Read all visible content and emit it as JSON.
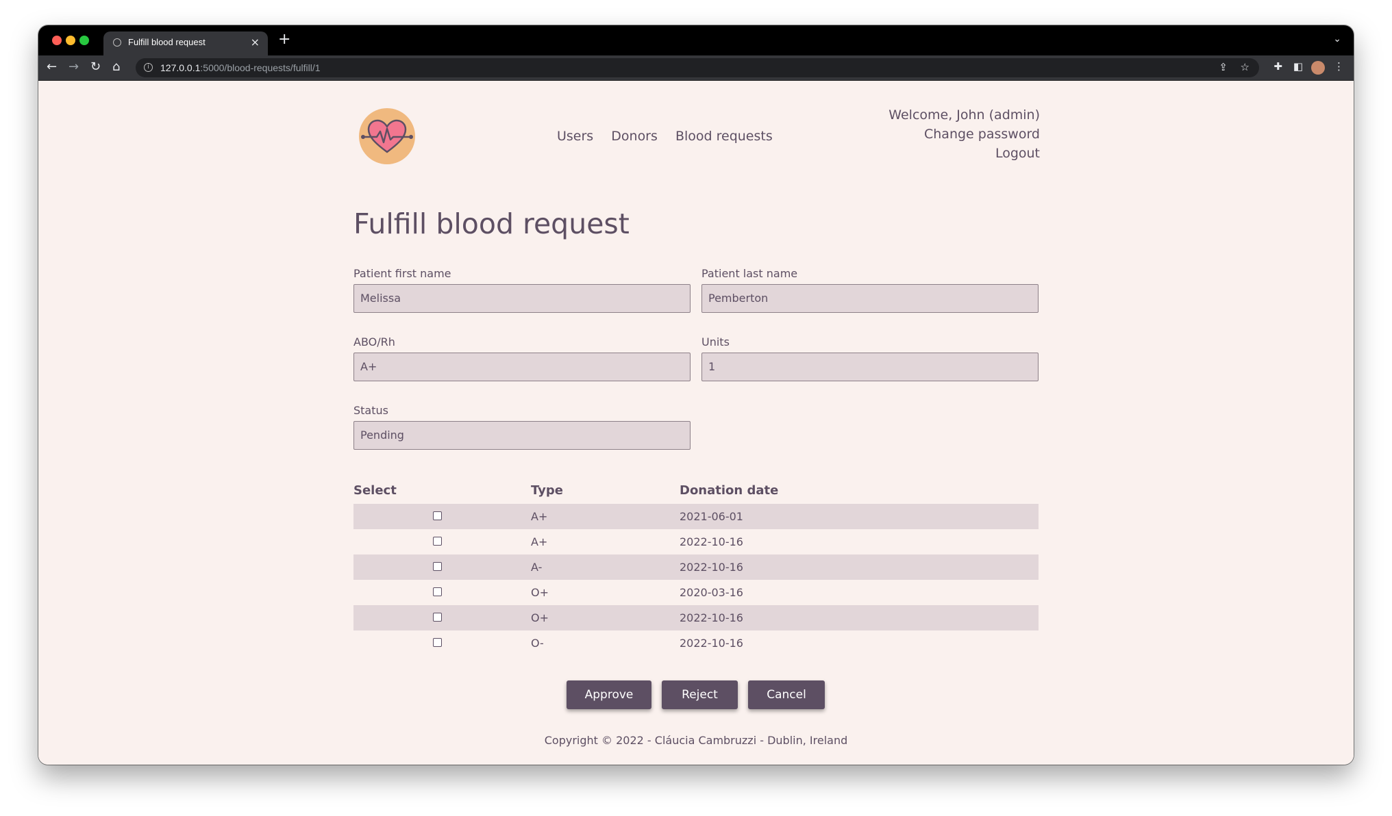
{
  "browser": {
    "tab_title": "Fulfill blood request",
    "url_host": "127.0.0.1",
    "url_path": ":5000/blood-requests/fulfill/1"
  },
  "nav": {
    "items": [
      "Users",
      "Donors",
      "Blood requests"
    ]
  },
  "user_menu": {
    "welcome": "Welcome, John (admin)",
    "change_password": "Change password",
    "logout": "Logout"
  },
  "page": {
    "title": "Fulfill blood request"
  },
  "form": {
    "first_name_label": "Patient first name",
    "first_name_value": "Melissa",
    "last_name_label": "Patient last name",
    "last_name_value": "Pemberton",
    "abo_label": "ABO/Rh",
    "abo_value": "A+",
    "units_label": "Units",
    "units_value": "1",
    "status_label": "Status",
    "status_value": "Pending"
  },
  "table": {
    "headers": [
      "Select",
      "Type",
      "Donation date"
    ],
    "rows": [
      {
        "type": "A+",
        "date": "2021-06-01",
        "checked": false
      },
      {
        "type": "A+",
        "date": "2022-10-16",
        "checked": false
      },
      {
        "type": "A-",
        "date": "2022-10-16",
        "checked": false
      },
      {
        "type": "O+",
        "date": "2020-03-16",
        "checked": false
      },
      {
        "type": "O+",
        "date": "2022-10-16",
        "checked": false
      },
      {
        "type": "O-",
        "date": "2022-10-16",
        "checked": false
      }
    ]
  },
  "buttons": {
    "approve": "Approve",
    "reject": "Reject",
    "cancel": "Cancel"
  },
  "footer": {
    "text": "Copyright © 2022 - Cláucia Cambruzzi - Dublin, Ireland"
  },
  "colors": {
    "page_bg": "#faf1ee",
    "text": "#5d4f63",
    "field_bg": "#e2d6d9",
    "button_bg": "#5d4f63",
    "logo_circle": "#f0b97f",
    "logo_heart": "#f2768f"
  }
}
